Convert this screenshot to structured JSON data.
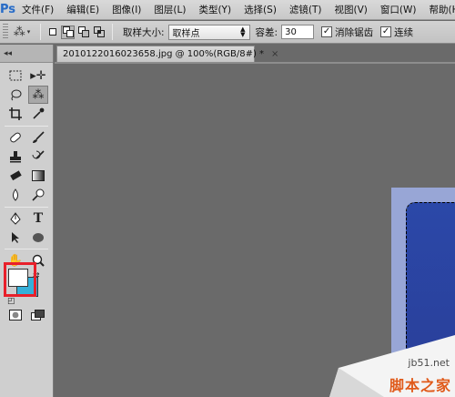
{
  "app": {
    "logo": "Ps"
  },
  "menu": [
    "文件(F)",
    "编辑(E)",
    "图像(I)",
    "图层(L)",
    "类型(Y)",
    "选择(S)",
    "滤镜(T)",
    "视图(V)",
    "窗口(W)",
    "帮助(H)"
  ],
  "options": {
    "sample_size_label": "取样大小:",
    "sample_size_value": "取样点",
    "tolerance_label": "容差:",
    "tolerance_value": "30",
    "antialias_label": "消除锯齿",
    "antialias_checked": true,
    "contiguous_label": "连续",
    "contiguous_checked": true
  },
  "document": {
    "tab_title": "2010122016023658.jpg @ 100%(RGB/8#) *",
    "close_glyph": "×"
  },
  "tools": {
    "collapse_glyph": "◂◂",
    "icons": [
      "rect-marquee-icon",
      "move-icon",
      "lasso-icon",
      "magic-wand-icon",
      "crop-icon",
      "eyedropper-icon",
      "healing-brush-icon",
      "brush-icon",
      "clone-stamp-icon",
      "history-brush-icon",
      "eraser-icon",
      "gradient-icon",
      "blur-icon",
      "dodge-icon",
      "pen-icon",
      "type-icon",
      "path-select-icon",
      "ellipse-icon",
      "hand-icon",
      "zoom-icon",
      "quick-mask-icon",
      "screen-mode-icon"
    ],
    "active": "magic-wand-icon",
    "foreground_color": "#ffffff",
    "background_color": "#36b0d9",
    "highlight_color": "#e8202a"
  },
  "watermark": {
    "url": "jb51.net",
    "name": "脚本之家"
  }
}
